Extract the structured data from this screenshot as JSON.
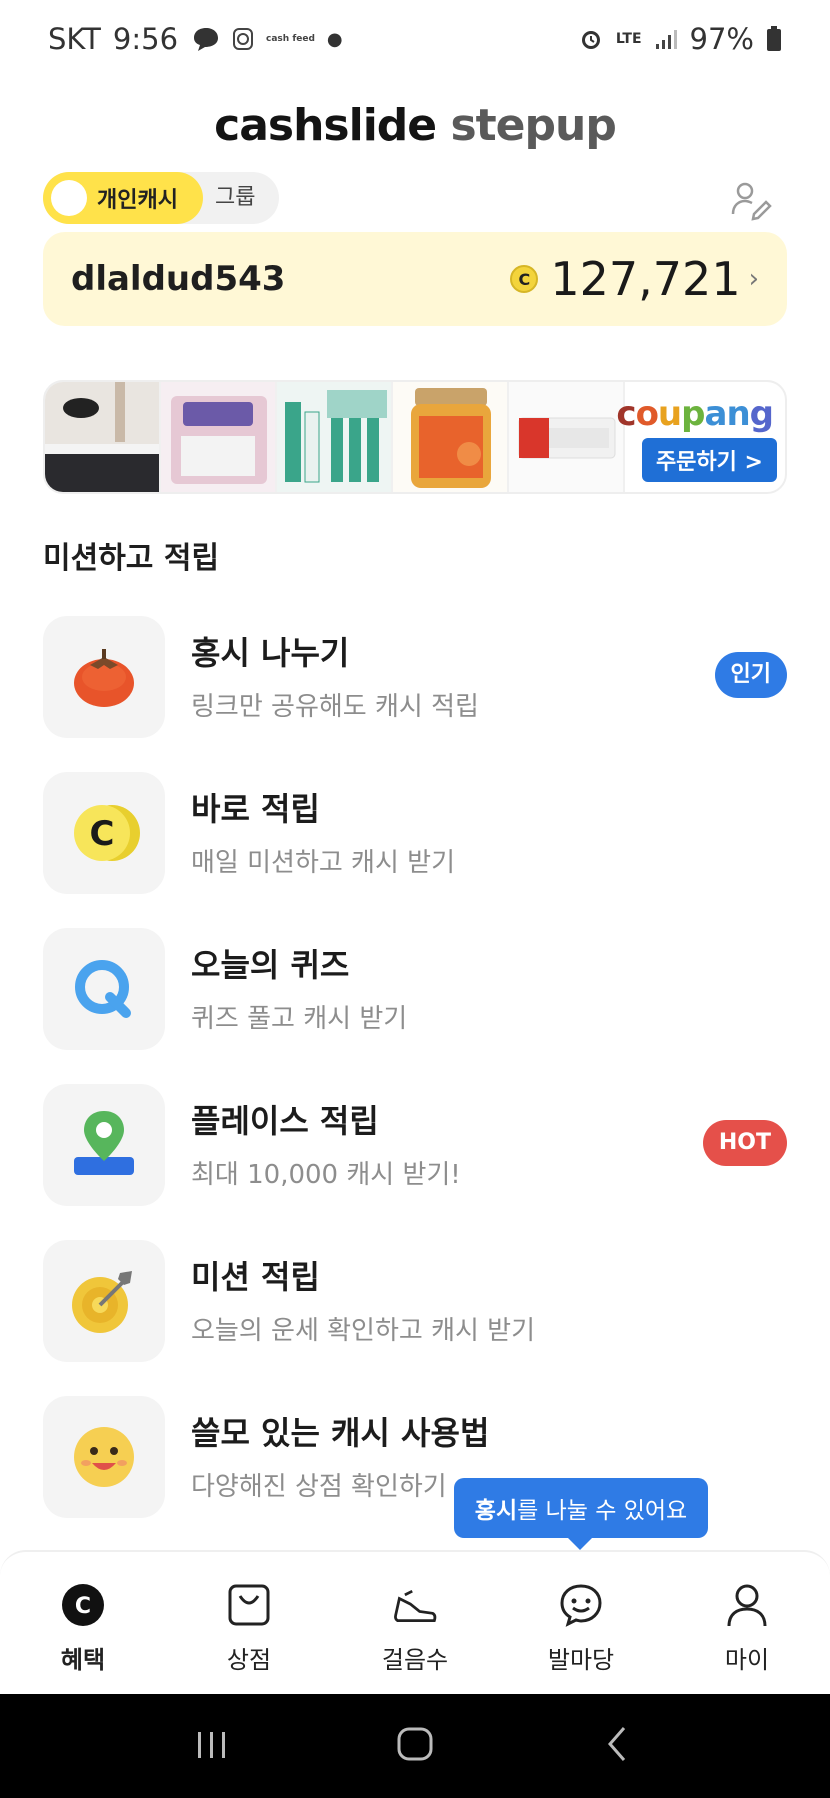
{
  "status_bar": {
    "carrier": "SKT",
    "time": "9:56",
    "cash_feed_logo": "cash feed",
    "network": "LTE",
    "battery": "97%"
  },
  "header": {
    "brand_main": "cashslide",
    "brand_sub": "stepup",
    "toggle_personal": "개인캐시",
    "toggle_group": "그룹",
    "username": "dlaldud543",
    "coin_symbol": "C",
    "balance": "127,721"
  },
  "ad": {
    "brand": "coupang",
    "order_label": "주문하기 >"
  },
  "section_title": "미션하고 적립",
  "missions": [
    {
      "title": "홍시 나누기",
      "subtitle": "링크만 공유해도 캐시 적립",
      "badge": "인기"
    },
    {
      "title": "바로 적립",
      "subtitle": "매일 미션하고 캐시 받기"
    },
    {
      "title": "오늘의 퀴즈",
      "subtitle": "퀴즈 풀고 캐시 받기"
    },
    {
      "title": "플레이스 적립",
      "subtitle": "최대 10,000 캐시 받기!",
      "badge": "HOT"
    },
    {
      "title": "미션 적립",
      "subtitle": "오늘의 운세 확인하고 캐시 받기"
    },
    {
      "title": "쓸모 있는 캐시 사용법",
      "subtitle": "다양해진 상점 확인하기"
    }
  ],
  "tooltip": {
    "bold": "홍시",
    "rest": "를 나눌 수 있어요"
  },
  "bottom_nav": [
    {
      "label": "혜택",
      "icon": "cash-c-icon",
      "active": true
    },
    {
      "label": "상점",
      "icon": "shopping-bag-icon"
    },
    {
      "label": "걸음수",
      "icon": "sneaker-icon"
    },
    {
      "label": "발마당",
      "icon": "smile-chat-icon"
    },
    {
      "label": "마이",
      "icon": "person-icon"
    }
  ],
  "colors": {
    "accent_yellow": "#ffe24a",
    "card_bg": "#fff8d6",
    "badge_blue": "#2f7be5",
    "badge_red": "#e5504a"
  }
}
